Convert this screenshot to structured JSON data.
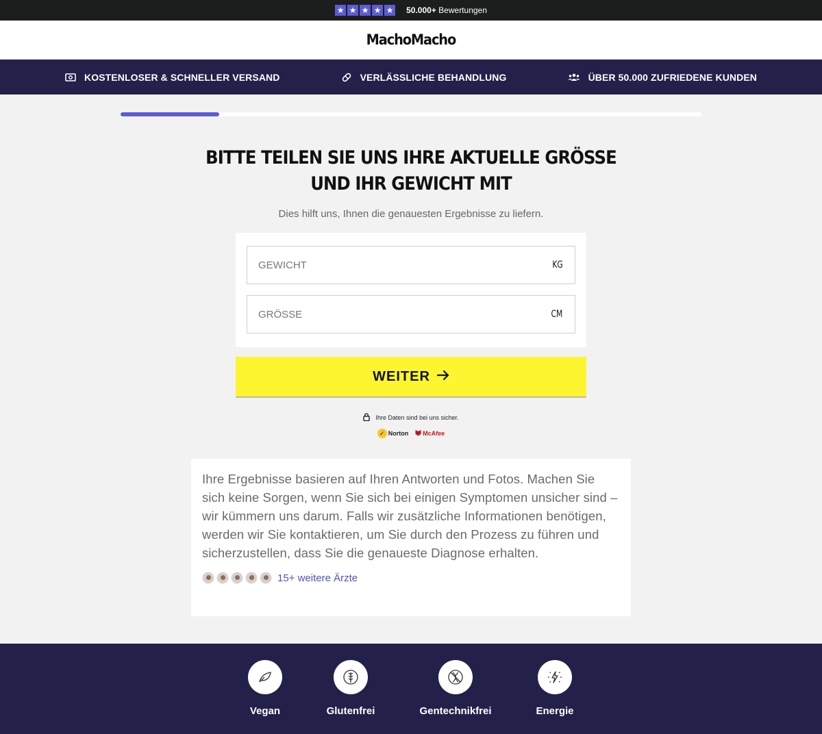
{
  "rating": {
    "stars": [
      "★",
      "★",
      "★",
      "★",
      "★"
    ],
    "count": "50.000+",
    "label": "Bewertungen"
  },
  "brand": {
    "logo": "MachoMacho"
  },
  "usp": [
    {
      "icon": "money-icon",
      "label": "KOSTENLOSER & SCHNELLER VERSAND"
    },
    {
      "icon": "pill-icon",
      "label": "VERLÄSSLICHE BEHANDLUNG"
    },
    {
      "icon": "users-icon",
      "label": "ÜBER 50.000 ZUFRIEDENE KUNDEN"
    }
  ],
  "progress": {
    "fraction": 0.17,
    "color": "#5b5bd6"
  },
  "question": {
    "title": "BITTE TEILEN SIE UNS IHRE AKTUELLE GRÖSSE UND IHR GEWICHT MIT",
    "subtitle": "Dies hilft uns, Ihnen die genauesten Ergebnisse zu liefern."
  },
  "form": {
    "weight": {
      "placeholder": "GEWICHT",
      "value": "",
      "unit": "KG"
    },
    "height": {
      "placeholder": "GRÖSSE",
      "value": "",
      "unit": "CM"
    }
  },
  "cta": {
    "label": "WEITER",
    "color": "#fdf52f"
  },
  "security": {
    "text": "Ihre Daten sind bei uns sicher.",
    "norton": "Norton",
    "mcafee": "McAfee"
  },
  "info": {
    "text": "Ihre Ergebnisse basieren auf Ihren Antworten und Fotos. Machen Sie sich keine Sorgen, wenn Sie sich bei einigen Symptomen unsicher sind – wir kümmern uns darum. Falls wir zusätzliche Informationen benötigen, werden wir Sie kontaktieren, um Sie durch den Prozess zu führen und sicherzustellen, dass Sie die genaueste Diagnose erhalten.",
    "doctors_link": "15+ weitere Ärzte"
  },
  "features": [
    {
      "icon": "leaf-icon",
      "label": "Vegan"
    },
    {
      "icon": "wheat-icon",
      "label": "Glutenfrei"
    },
    {
      "icon": "dna-icon",
      "label": "Gentechnikfrei"
    },
    {
      "icon": "lightning-icon",
      "label": "Energie"
    }
  ],
  "colors": {
    "navy": "#23204a",
    "accent": "#5b5bd6",
    "link": "#4f52b8"
  }
}
